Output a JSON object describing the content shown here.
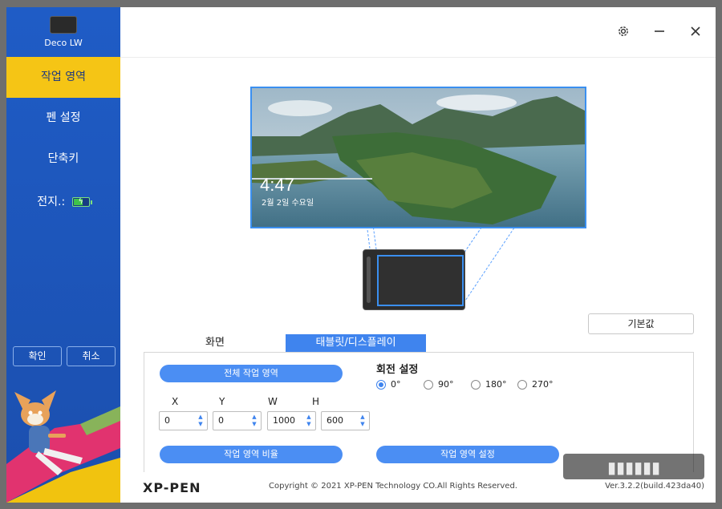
{
  "device": {
    "name": "Deco LW"
  },
  "sidebar": {
    "items": [
      {
        "label": "작업 영역"
      },
      {
        "label": "펜 설정"
      },
      {
        "label": "단축키"
      },
      {
        "label": "전지.:"
      }
    ],
    "battery_icon": "battery-charging-icon",
    "confirm_label": "확인",
    "cancel_label": "취소"
  },
  "header": {
    "icons": [
      "gear-icon",
      "minimize-icon",
      "close-icon"
    ]
  },
  "preview": {
    "time": "4:47",
    "date": "2월 2일 수요일"
  },
  "default_label": "기본값",
  "tabs": [
    {
      "label": "화면"
    },
    {
      "label": "태블릿/디스플레이"
    }
  ],
  "work_area": {
    "full_area_label": "전체 작업 영역",
    "ratio_label": "작업 영역 비율",
    "setting_label": "작업 영역 설정",
    "fields": [
      {
        "label": "X",
        "value": "0"
      },
      {
        "label": "Y",
        "value": "0"
      },
      {
        "label": "W",
        "value": "1000"
      },
      {
        "label": "H",
        "value": "600"
      }
    ]
  },
  "rotation": {
    "title": "회전 설정",
    "options": [
      "0°",
      "90°",
      "180°",
      "270°"
    ],
    "selected": "0°"
  },
  "footer": {
    "logo": "XP-PEN",
    "copyright": "Copyright © 2021 XP-PEN Technology CO.All Rights Reserved.",
    "version": "Ver.3.2.2(build.423da40)"
  },
  "colors": {
    "sidebar": "#1f5cc6",
    "active": "#f5c515",
    "accent": "#3f84ee"
  }
}
